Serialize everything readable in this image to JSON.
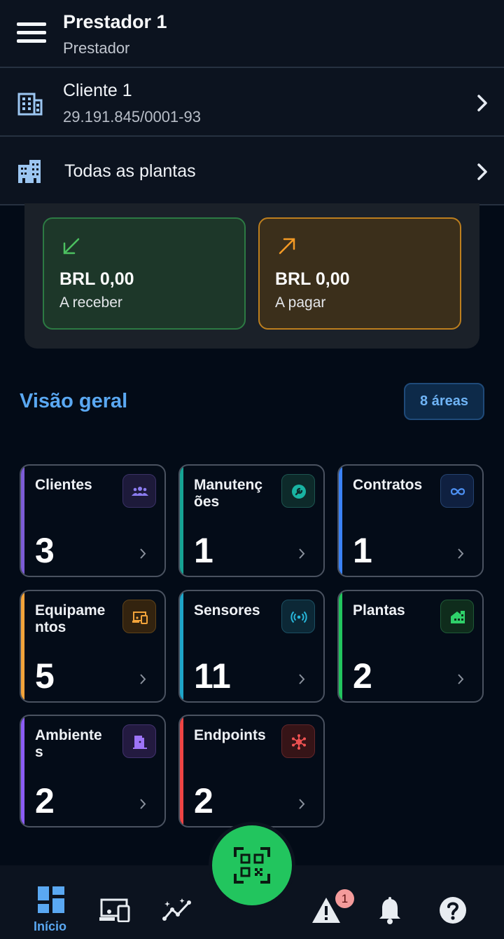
{
  "header": {
    "title": "Prestador 1",
    "subtitle": "Prestador"
  },
  "client_selector": {
    "name": "Cliente 1",
    "document": "29.191.845/0001-93"
  },
  "plant_selector": {
    "label": "Todas as plantas"
  },
  "finance": {
    "receivable": {
      "amount": "BRL 0,00",
      "label": "A receber"
    },
    "payable": {
      "amount": "BRL 0,00",
      "label": "A pagar"
    }
  },
  "overview": {
    "title": "Visão geral",
    "areas_badge": "8 áreas",
    "tiles": [
      {
        "label": "Clientes",
        "value": "3",
        "icon": "users-icon",
        "accent": "#7c5cd6"
      },
      {
        "label": "Manutenç\nões",
        "value": "1",
        "icon": "wrench-icon",
        "accent": "#16a394"
      },
      {
        "label": "Contratos",
        "value": "1",
        "icon": "infinity-icon",
        "accent": "#3b82f6"
      },
      {
        "label": "Equipame\nntos",
        "value": "5",
        "icon": "devices-icon",
        "accent": "#f2a33a"
      },
      {
        "label": "Sensores",
        "value": "11",
        "icon": "sensor-icon",
        "accent": "#1ea5c9"
      },
      {
        "label": "Plantas",
        "value": "2",
        "icon": "plant-icon",
        "accent": "#22c55e"
      },
      {
        "label": "Ambiente\ns",
        "value": "2",
        "icon": "door-icon",
        "accent": "#8b5cf6"
      },
      {
        "label": "Endpoints",
        "value": "2",
        "icon": "network-icon",
        "accent": "#ef4444"
      }
    ]
  },
  "bottom_nav": {
    "home_label": "Início",
    "alerts_count": "1"
  },
  "colors": {
    "accent_blue": "#5aa8f2",
    "fab_green": "#22c55e",
    "receivable_green": "#2c7a43",
    "payable_orange": "#bd7f1e"
  }
}
